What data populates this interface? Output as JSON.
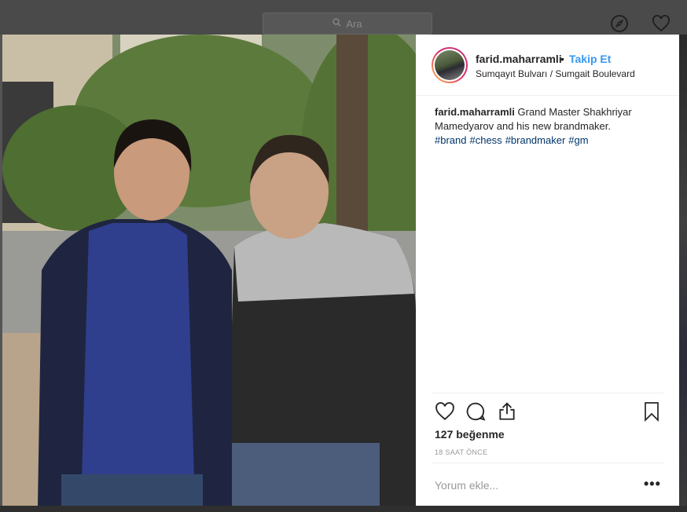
{
  "search": {
    "placeholder": "Ara"
  },
  "nav": {
    "explore_icon": "compass-icon",
    "activity_icon": "heart-icon"
  },
  "post": {
    "image_alt": "Two men standing in front of trees",
    "username": "farid.maharramli",
    "separator": "•",
    "follow_label": "Takip Et",
    "location": "Sumqayıt Bulvarı / Sumgait Boulevard",
    "caption_user": "farid.maharramli",
    "caption_text": "Grand Master Shakhriyar Mamedyarov and his new brandmaker.",
    "hashtags": [
      "#brand",
      "#chess",
      "#brandmaker",
      "#gm"
    ],
    "likes": "127 beğenme",
    "time_ago": "18 SAAT ÖNCE",
    "comment_placeholder": "Yorum ekle...",
    "more_label": "•••"
  },
  "colors": {
    "link_blue": "#3897f0",
    "hashtag": "#003569",
    "text": "#262626",
    "muted": "#999999"
  }
}
